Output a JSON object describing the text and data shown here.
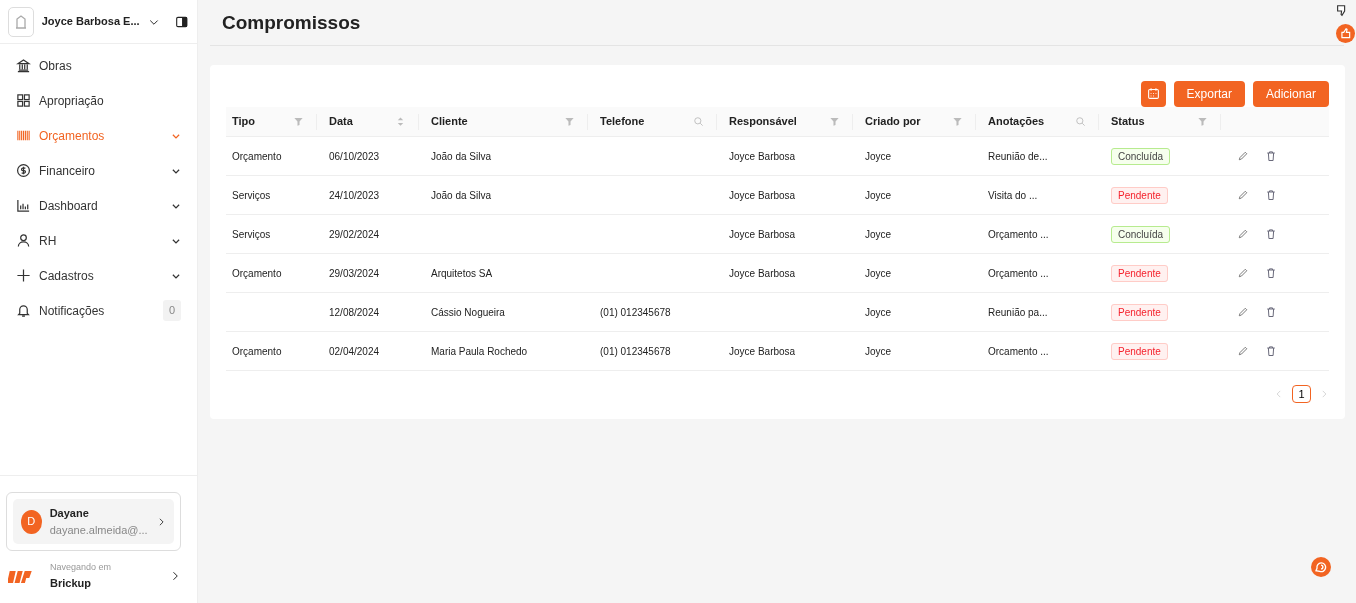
{
  "sidebar": {
    "company": "Joyce Barbosa E...",
    "items": [
      {
        "label": "Obras",
        "selected": false,
        "expandable": false
      },
      {
        "label": "Apropriação",
        "selected": false,
        "expandable": false
      },
      {
        "label": "Orçamentos",
        "selected": true,
        "expandable": true
      },
      {
        "label": "Financeiro",
        "selected": false,
        "expandable": true
      },
      {
        "label": "Dashboard",
        "selected": false,
        "expandable": true
      },
      {
        "label": "RH",
        "selected": false,
        "expandable": true
      },
      {
        "label": "Cadastros",
        "selected": false,
        "expandable": true
      },
      {
        "label": "Notificações",
        "selected": false,
        "expandable": false,
        "count": "0"
      }
    ],
    "user": {
      "initial": "D",
      "name": "Dayane",
      "email": "dayane.almeida@..."
    },
    "workspace": {
      "caption": "Navegando em",
      "name": "Brickup"
    }
  },
  "page": {
    "title": "Compromissos"
  },
  "toolbar": {
    "buttons": [
      "Exportar",
      "Adicionar"
    ]
  },
  "table": {
    "columns": [
      {
        "label": "Tipo",
        "kind": "filter"
      },
      {
        "label": "Data",
        "kind": "sort"
      },
      {
        "label": "Cliente",
        "kind": "filter"
      },
      {
        "label": "Telefone",
        "kind": "search"
      },
      {
        "label": "Responsável",
        "kind": "filter"
      },
      {
        "label": "Criado por",
        "kind": "filter"
      },
      {
        "label": "Anotações",
        "kind": "search"
      },
      {
        "label": "Status",
        "kind": "filter"
      }
    ],
    "rows": [
      {
        "cells": [
          "Orçamento",
          "06/10/2023",
          "João da Silva",
          "",
          "Joyce Barbosa",
          "Joyce",
          "Reunião de..."
        ],
        "status": {
          "label": "Concluída",
          "kind": "done"
        }
      },
      {
        "cells": [
          "Serviços",
          "24/10/2023",
          "João da Silva",
          "",
          "Joyce Barbosa",
          "Joyce",
          "Visita do ..."
        ],
        "status": {
          "label": "Pendente",
          "kind": "pending"
        }
      },
      {
        "cells": [
          "Serviços",
          "29/02/2024",
          "",
          "",
          "Joyce Barbosa",
          "Joyce",
          "Orçamento ..."
        ],
        "status": {
          "label": "Concluída",
          "kind": "done"
        }
      },
      {
        "cells": [
          "Orçamento",
          "29/03/2024",
          "Arquitetos SA",
          "",
          "Joyce Barbosa",
          "Joyce",
          "Orçamento ..."
        ],
        "status": {
          "label": "Pendente",
          "kind": "pending"
        }
      },
      {
        "cells": [
          "",
          "12/08/2024",
          "Cássio Nogueira",
          "(01) 012345678",
          "",
          "Joyce",
          "Reunião pa..."
        ],
        "status": {
          "label": "Pendente",
          "kind": "pending"
        }
      },
      {
        "cells": [
          "Orçamento",
          "02/04/2024",
          "Maria Paula Rochedo",
          "(01) 012345678",
          "Joyce Barbosa",
          "Joyce",
          "Orcamento ..."
        ],
        "status": {
          "label": "Pendente",
          "kind": "pending"
        }
      }
    ]
  },
  "pagination": {
    "pages": [
      {
        "label": "1",
        "selected": true
      }
    ]
  }
}
